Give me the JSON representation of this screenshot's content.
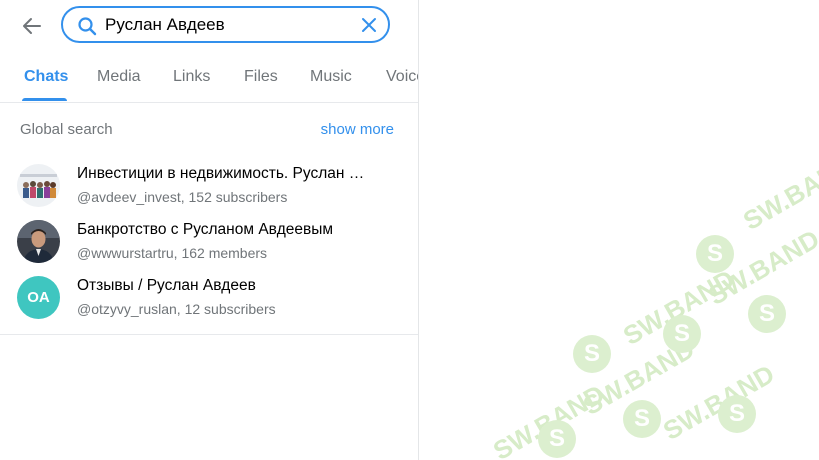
{
  "search": {
    "value": "Руслан Авдеев"
  },
  "tabs": [
    "Chats",
    "Media",
    "Links",
    "Files",
    "Music",
    "Voice"
  ],
  "active_tab": "Chats",
  "section": {
    "title": "Global search",
    "show_more": "show more"
  },
  "results": [
    {
      "title": "Инвестиции в недвижимость. Руслан Авдеев",
      "subtitle": "@avdeev_invest, 152 subscribers",
      "avatar": "group-photo"
    },
    {
      "title": "Банкротство с Русланом Авдеевым",
      "subtitle": "@wwwurstartru, 162 members",
      "avatar": "portrait-photo"
    },
    {
      "title": "Отзывы / Руслан Авдеев",
      "subtitle": "@otzyvy_ruslan, 12 subscribers",
      "avatar_initials": "OA",
      "avatar_color": "#3fc6c0"
    }
  ],
  "colors": {
    "accent": "#3390ec",
    "secondary_text": "#707579",
    "watermark": "#8cc63f"
  },
  "watermark": {
    "text": "SW.BAND",
    "logo_letter": "S"
  }
}
